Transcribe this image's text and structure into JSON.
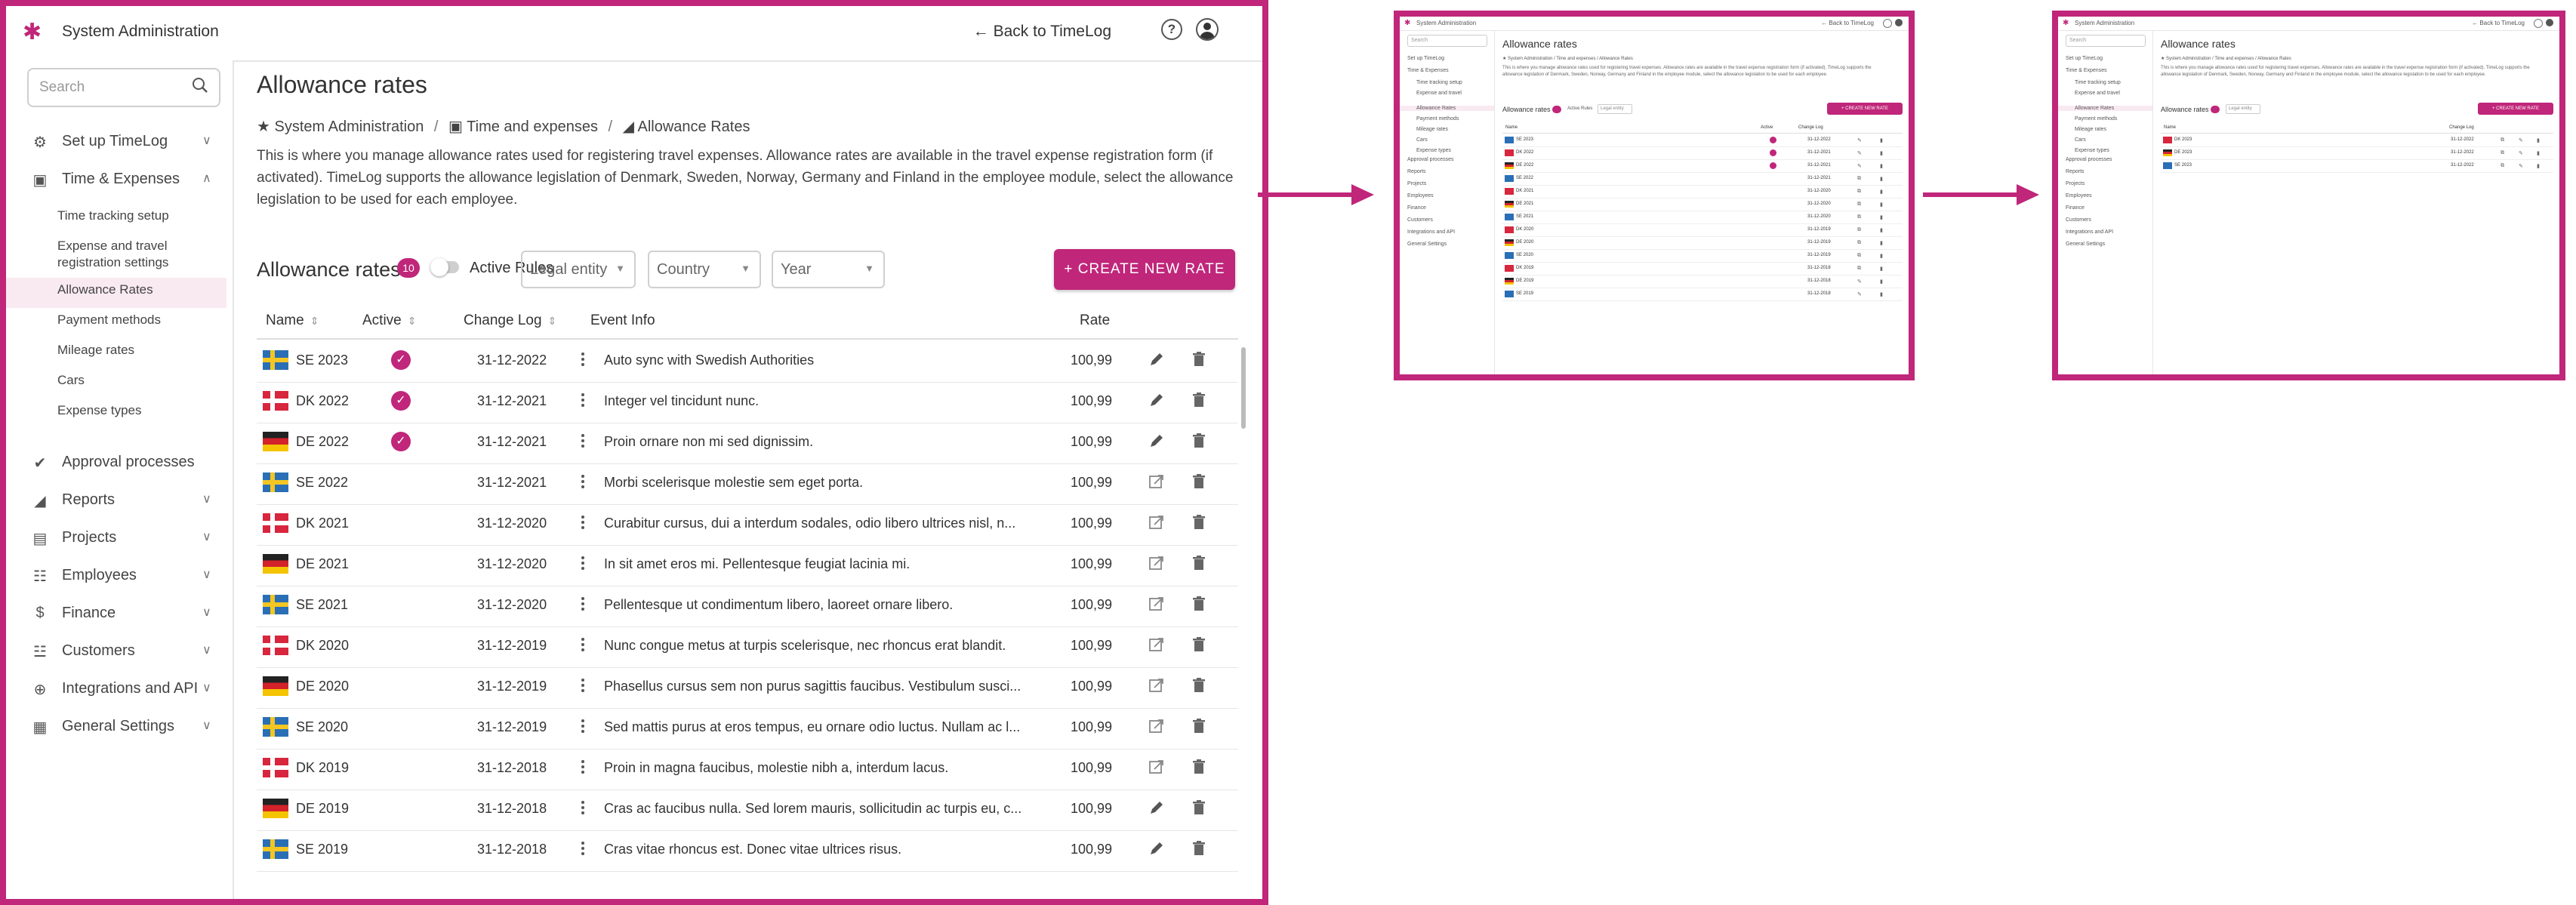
{
  "app": {
    "name": "System Administration",
    "back_link": "← Back to TimeLog",
    "help_glyph": "?"
  },
  "colors": {
    "accent": "#c0267a",
    "frame": "#c0267a"
  },
  "sidebar": {
    "search_placeholder": "Search",
    "nav": [
      {
        "key": "setup",
        "label": "Set up TimeLog",
        "icon": "gear-icon",
        "chevron": "∨"
      },
      {
        "key": "time-expenses",
        "label": "Time & Expenses",
        "icon": "calendar-icon",
        "chevron": "∧"
      },
      {
        "key": "approval",
        "label": "Approval processes",
        "icon": "check-circle-icon",
        "chevron": ""
      },
      {
        "key": "reports",
        "label": "Reports",
        "icon": "chart-icon",
        "chevron": "∨"
      },
      {
        "key": "projects",
        "label": "Projects",
        "icon": "clipboard-icon",
        "chevron": "∨"
      },
      {
        "key": "employees",
        "label": "Employees",
        "icon": "people-icon",
        "chevron": "∨"
      },
      {
        "key": "finance",
        "label": "Finance",
        "icon": "dollar-icon",
        "chevron": "∨"
      },
      {
        "key": "customers",
        "label": "Customers",
        "icon": "group-icon",
        "chevron": "∨"
      },
      {
        "key": "integrations",
        "label": "Integrations and API",
        "icon": "plug-icon",
        "chevron": "∨"
      },
      {
        "key": "general",
        "label": "General Settings",
        "icon": "settings-icon",
        "chevron": "∨"
      }
    ],
    "sub": [
      {
        "label": "Time tracking setup"
      },
      {
        "label": "Expense and travel",
        "label2": "registration settings"
      },
      {
        "label": "Allowance Rates",
        "active": true
      },
      {
        "label": "Payment methods"
      },
      {
        "label": "Mileage rates"
      },
      {
        "label": "Cars"
      },
      {
        "label": "Expense types"
      }
    ]
  },
  "page": {
    "title": "Allowance rates",
    "breadcrumb": [
      "System Administration",
      "Time and expenses",
      "Allowance Rates"
    ],
    "description": "This is where you manage allowance rates used for registering travel expenses. Allowance rates are available in the travel expense registration form (if activated). TimeLog supports the allowance legislation of Denmark, Sweden, Norway, Germany and Finland in the employee module, select the allowance legislation to be used for each employee.",
    "section_title": "Allowance rates",
    "count_badge": "10",
    "active_rules_label": "Active Rules",
    "filters": {
      "legal_entity": "Legal entity",
      "country": "Country",
      "year": "Year"
    },
    "create_button": "+ CREATE NEW RATE"
  },
  "table": {
    "headers": {
      "name": "Name",
      "active": "Active",
      "changelog": "Change Log",
      "event": "Event Info",
      "rate": "Rate"
    },
    "rows": [
      {
        "country": "SE",
        "name": "SE 2023",
        "active": true,
        "date": "31-12-2022",
        "event": "Auto sync with Swedish Authorities",
        "rate": "100,99",
        "action": "edit"
      },
      {
        "country": "DK",
        "name": "DK 2022",
        "active": true,
        "date": "31-12-2021",
        "event": "Integer vel tincidunt nunc.",
        "rate": "100,99",
        "action": "edit"
      },
      {
        "country": "DE",
        "name": "DE 2022",
        "active": true,
        "date": "31-12-2021",
        "event": "Proin ornare non mi sed dignissim.",
        "rate": "100,99",
        "action": "edit"
      },
      {
        "country": "SE",
        "name": "SE 2022",
        "active": false,
        "date": "31-12-2021",
        "event": "Morbi scelerisque molestie sem eget porta.",
        "rate": "100,99",
        "action": "open"
      },
      {
        "country": "DK",
        "name": "DK 2021",
        "active": false,
        "date": "31-12-2020",
        "event": "Curabitur cursus, dui a interdum sodales, odio libero ultrices nisl, n...",
        "rate": "100,99",
        "action": "open"
      },
      {
        "country": "DE",
        "name": "DE 2021",
        "active": false,
        "date": "31-12-2020",
        "event": "In sit amet eros mi. Pellentesque feugiat lacinia mi.",
        "rate": "100,99",
        "action": "open"
      },
      {
        "country": "SE",
        "name": "SE 2021",
        "active": false,
        "date": "31-12-2020",
        "event": "Pellentesque ut condimentum libero, laoreet ornare libero.",
        "rate": "100,99",
        "action": "open"
      },
      {
        "country": "DK",
        "name": "DK 2020",
        "active": false,
        "date": "31-12-2019",
        "event": "Nunc congue metus at turpis scelerisque, nec rhoncus erat blandit.",
        "rate": "100,99",
        "action": "open"
      },
      {
        "country": "DE",
        "name": "DE 2020",
        "active": false,
        "date": "31-12-2019",
        "event": "Phasellus cursus sem non purus sagittis faucibus. Vestibulum susci...",
        "rate": "100,99",
        "action": "open"
      },
      {
        "country": "SE",
        "name": "SE 2020",
        "active": false,
        "date": "31-12-2019",
        "event": "Sed mattis purus at eros tempus, eu ornare odio luctus. Nullam ac l...",
        "rate": "100,99",
        "action": "open"
      },
      {
        "country": "DK",
        "name": "DK 2019",
        "active": false,
        "date": "31-12-2018",
        "event": "Proin in magna faucibus, molestie nibh a, interdum lacus.",
        "rate": "100,99",
        "action": "open"
      },
      {
        "country": "DE",
        "name": "DE 2019",
        "active": false,
        "date": "31-12-2018",
        "event": "Cras ac faucibus nulla. Sed lorem mauris, sollicitudin ac turpis eu, c...",
        "rate": "100,99",
        "action": "edit"
      },
      {
        "country": "SE",
        "name": "SE 2019",
        "active": false,
        "date": "31-12-2018",
        "event": "Cras vitae rhoncus est. Donec vitae ultrices risus.",
        "rate": "100,99",
        "action": "edit"
      }
    ]
  },
  "thumb2": {
    "rows": [
      {
        "country": "DK",
        "name": "DK 2023"
      },
      {
        "country": "DE",
        "name": "DE 2023"
      },
      {
        "country": "SE",
        "name": "SE 2023"
      }
    ]
  }
}
